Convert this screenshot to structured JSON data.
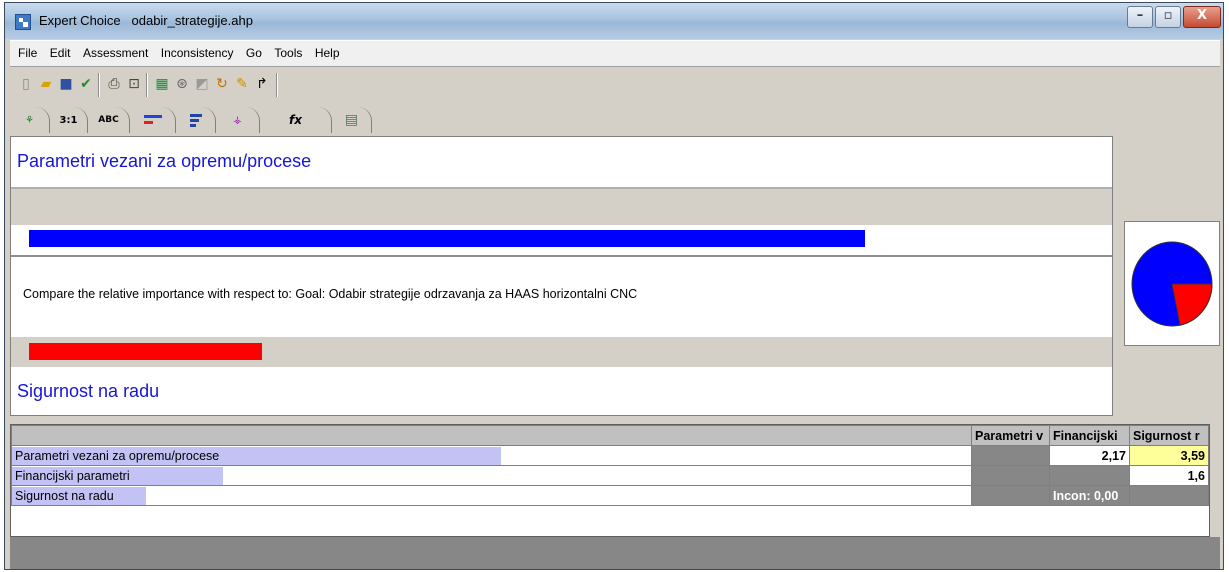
{
  "window": {
    "app_name": "Expert Choice",
    "file_name": "odabir_strategije.ahp",
    "controls": [
      "minimize",
      "maximize",
      "close"
    ]
  },
  "menu": [
    "File",
    "Edit",
    "Assessment",
    "Inconsistency",
    "Go",
    "Tools",
    "Help"
  ],
  "toolbar": [
    "new-file-icon",
    "open-folder-icon",
    "save-icon",
    "check-icon",
    "print-icon",
    "print-preview-icon",
    "calculator-icon",
    "synthesize-icon",
    "model-icon",
    "rotate-icon",
    "wand-icon",
    "arrow-up-icon"
  ],
  "tabs": [
    {
      "icon": "tree-icon",
      "label": ""
    },
    {
      "icon": "numerical-icon",
      "label": "3:1"
    },
    {
      "icon": "verbal-icon",
      "label": "ABC"
    },
    {
      "icon": "graphical-icon",
      "label": ""
    },
    {
      "icon": "questionnaire-icon",
      "label": ""
    },
    {
      "icon": "network-icon",
      "label": ""
    },
    {
      "icon": "formula-icon",
      "label": "fx"
    },
    {
      "icon": "spreadsheet-icon",
      "label": ""
    }
  ],
  "comparison": {
    "left_item": "Parametri vezani za opremu/procese",
    "instruction": "Compare the relative importance with respect to: Goal: Odabir strategije odrzavanja za HAAS horizontalni CNC",
    "right_item": "Sigurnost na radu",
    "left_share": 0.782,
    "right_share": 0.218,
    "left_color": "#0000ff",
    "right_color": "#ff0000"
  },
  "matrix": {
    "columns": [
      "Parametri v",
      "Financijski",
      "Sigurnost r"
    ],
    "rows": [
      {
        "name": "Parametri vezani za opremu/procese",
        "bar": 0.51,
        "cells": [
          "",
          "2,17",
          "3,59"
        ]
      },
      {
        "name": "Financijski parametri",
        "bar": 0.22,
        "cells": [
          "",
          "",
          "1,6"
        ]
      },
      {
        "name": "Sigurnost na radu",
        "bar": 0.14,
        "cells": [
          "",
          "Incon: 0,00",
          ""
        ]
      }
    ],
    "highlight_color": "#ffff99",
    "bar_color": "#c2c2f4"
  }
}
